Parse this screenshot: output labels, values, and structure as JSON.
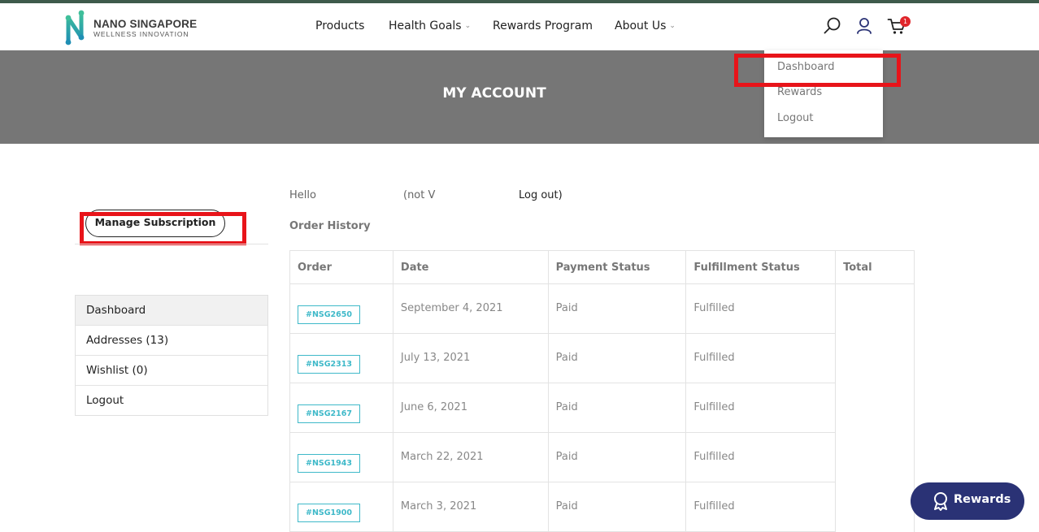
{
  "brand": {
    "name": "NANO SINGAPORE",
    "tagline": "WELLNESS INNOVATION"
  },
  "nav": {
    "products": "Products",
    "health_goals": "Health Goals",
    "rewards_program": "Rewards Program",
    "about_us": "About Us"
  },
  "cart": {
    "count": "1"
  },
  "banner": {
    "title": "MY ACCOUNT"
  },
  "account_dropdown": {
    "dashboard": "Dashboard",
    "rewards": "Rewards",
    "logout": "Logout"
  },
  "greeting": {
    "hello": "Hello",
    "not_prefix": "(not V",
    "logout_suffix": "Log out)"
  },
  "order_history": {
    "title": "Order History"
  },
  "sidebar": {
    "manage_subscription": "Manage Subscription",
    "items": [
      "Dashboard",
      "Addresses (13)",
      "Wishlist (0)",
      "Logout"
    ]
  },
  "orders": {
    "headers": [
      "Order",
      "Date",
      "Payment Status",
      "Fulfillment Status",
      "Total"
    ],
    "rows": [
      {
        "order": "#NSG2650",
        "date": "September 4, 2021",
        "payment": "Paid",
        "fulfillment": "Fulfilled"
      },
      {
        "order": "#NSG2313",
        "date": "July 13, 2021",
        "payment": "Paid",
        "fulfillment": "Fulfilled"
      },
      {
        "order": "#NSG2167",
        "date": "June 6, 2021",
        "payment": "Paid",
        "fulfillment": "Fulfilled"
      },
      {
        "order": "#NSG1943",
        "date": "March 22, 2021",
        "payment": "Paid",
        "fulfillment": "Fulfilled"
      },
      {
        "order": "#NSG1900",
        "date": "March 3, 2021",
        "payment": "Paid",
        "fulfillment": "Fulfilled"
      }
    ]
  },
  "rewards_launcher": {
    "label": "Rewards"
  },
  "colors": {
    "accent_teal": "#3fb9c9",
    "banner_gray": "#767676",
    "rewards_navy": "#2a3275",
    "highlight_red": "#e8141a",
    "badge_red": "#e0262b"
  },
  "icons": {
    "search": "search-icon",
    "account": "user-icon",
    "cart": "cart-icon",
    "rewards": "ribbon-badge-icon"
  }
}
